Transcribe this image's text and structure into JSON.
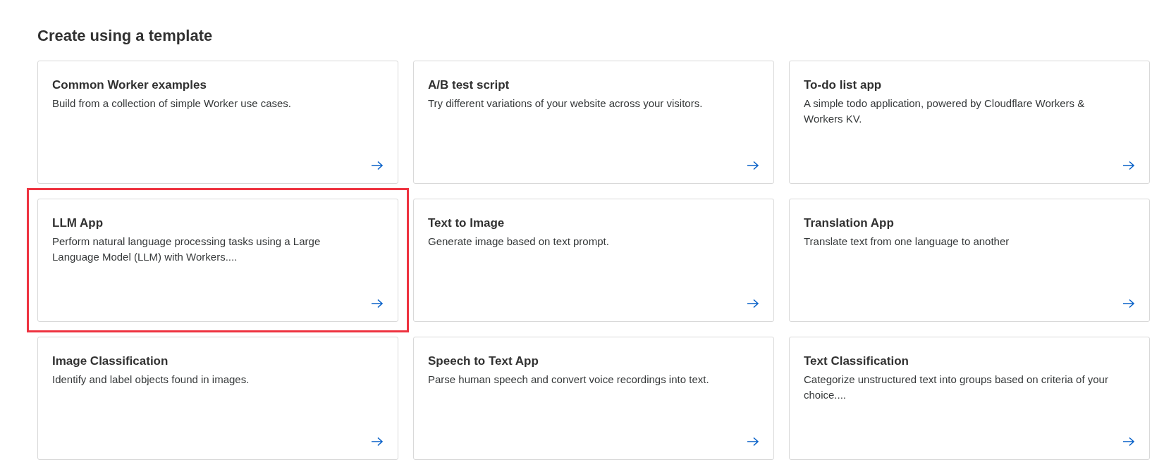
{
  "heading": "Create using a template",
  "templates": [
    {
      "title": "Common Worker examples",
      "description": "Build from a collection of simple Worker use cases.",
      "highlighted": false
    },
    {
      "title": "A/B test script",
      "description": "Try different variations of your website across your visitors.",
      "highlighted": false
    },
    {
      "title": "To-do list app",
      "description": "A simple todo application, powered by Cloudflare Workers & Workers KV.",
      "highlighted": false
    },
    {
      "title": "LLM App",
      "description": "Perform natural language processing tasks using a Large Language Model (LLM) with Workers....",
      "highlighted": true
    },
    {
      "title": "Text to Image",
      "description": "Generate image based on text prompt.",
      "highlighted": false
    },
    {
      "title": "Translation App",
      "description": "Translate text from one language to another",
      "highlighted": false
    },
    {
      "title": "Image Classification",
      "description": "Identify and label objects found in images.",
      "highlighted": false
    },
    {
      "title": "Speech to Text App",
      "description": "Parse human speech and convert voice recordings into text.",
      "highlighted": false
    },
    {
      "title": "Text Classification",
      "description": "Categorize unstructured text into groups based on criteria of your choice....",
      "highlighted": false
    }
  ]
}
